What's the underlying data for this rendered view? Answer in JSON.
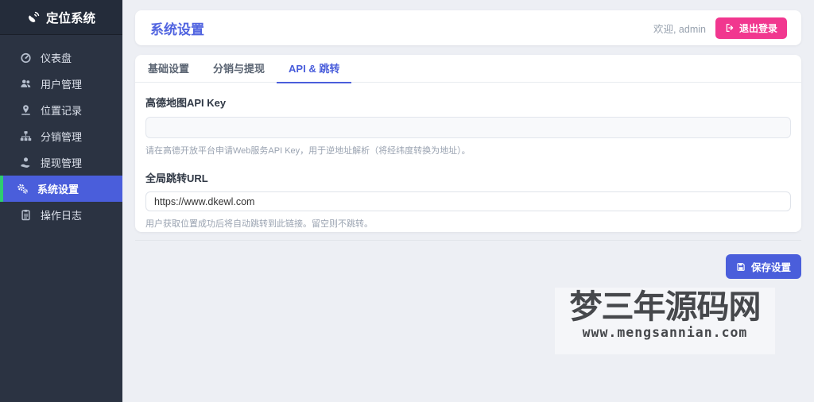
{
  "app": {
    "title": "定位系统"
  },
  "sidebar": {
    "items": [
      {
        "label": "仪表盘",
        "icon": "tachometer-icon",
        "active": false
      },
      {
        "label": "用户管理",
        "icon": "users-icon",
        "active": false
      },
      {
        "label": "位置记录",
        "icon": "map-marker-icon",
        "active": false
      },
      {
        "label": "分销管理",
        "icon": "sitemap-icon",
        "active": false
      },
      {
        "label": "提现管理",
        "icon": "hand-holding-money-icon",
        "active": false
      },
      {
        "label": "系统设置",
        "icon": "cogs-icon",
        "active": true
      },
      {
        "label": "操作日志",
        "icon": "clipboard-icon",
        "active": false
      }
    ]
  },
  "header": {
    "title": "系统设置",
    "welcome": "欢迎, admin",
    "logout_label": "退出登录"
  },
  "tabs": [
    {
      "label": "基础设置",
      "active": false
    },
    {
      "label": "分销与提现",
      "active": false
    },
    {
      "label": "API & 跳转",
      "active": true
    }
  ],
  "form": {
    "amap_key": {
      "label": "高德地图API Key",
      "value": "",
      "help": "请在高德开放平台申请Web服务API Key，用于逆地址解析（将经纬度转换为地址）。"
    },
    "redirect_url": {
      "label": "全局跳转URL",
      "value": "https://www.dkewl.com",
      "help": "用户获取位置成功后将自动跳转到此链接。留空则不跳转。"
    }
  },
  "actions": {
    "save_label": "保存设置"
  },
  "watermark": {
    "title": "梦三年源码网",
    "url": "www.mengsannian.com"
  },
  "colors": {
    "primary_blue": "#4a5edb",
    "title_blue": "#5164e0",
    "logout_pink": "#f1378f",
    "active_green_border": "#2ecc71",
    "sidebar_bg": "#2b3342",
    "page_bg": "#edeff4"
  }
}
